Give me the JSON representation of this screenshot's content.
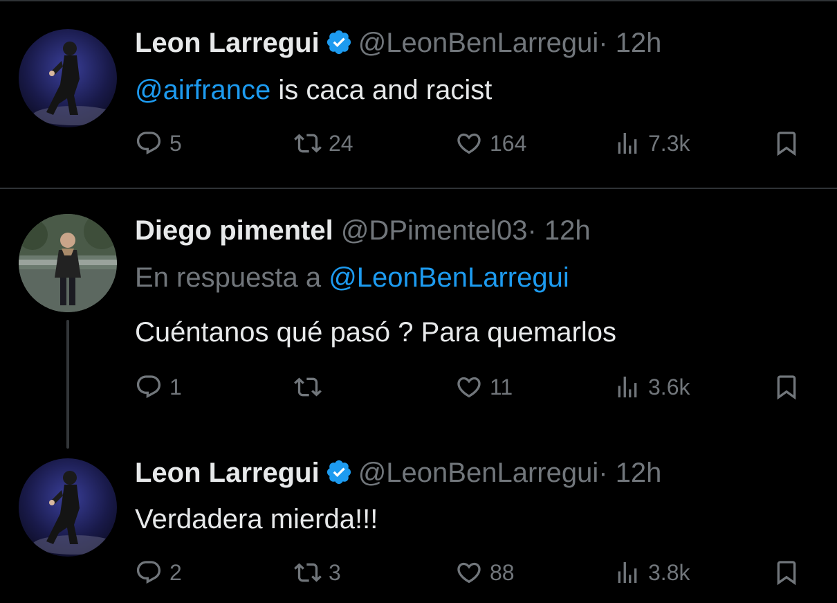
{
  "tweets": [
    {
      "name": "Leon Larregui",
      "verified": true,
      "handle": "@LeonBenLarregui",
      "dot": "·",
      "time": "12h",
      "text_mention": "@airfrance",
      "text": " is caca and racist",
      "replies": "5",
      "retweets": "24",
      "likes": "164",
      "views": "7.3k"
    },
    {
      "name": "Diego pimentel",
      "verified": false,
      "handle": "@DPimentel03",
      "dot": "·",
      "time": "12h",
      "reply_prefix": "En respuesta a ",
      "reply_handle": "@LeonBenLarregui",
      "text": "Cuéntanos qué pasó ? Para quemarlos",
      "replies": "1",
      "retweets": "",
      "likes": "11",
      "views": "3.6k"
    },
    {
      "name": "Leon Larregui",
      "verified": true,
      "handle": "@LeonBenLarregui",
      "dot": "·",
      "time": "12h",
      "text": "Verdadera mierda!!!",
      "replies": "2",
      "retweets": "3",
      "likes": "88",
      "views": "3.8k"
    }
  ],
  "icons": [
    "reply-icon",
    "retweet-icon",
    "like-icon",
    "views-icon",
    "bookmark-icon",
    "verified-icon"
  ],
  "colors": {
    "background": "#000000",
    "text": "#e7e9ea",
    "secondary": "#71767b",
    "link": "#1d9bf0"
  }
}
